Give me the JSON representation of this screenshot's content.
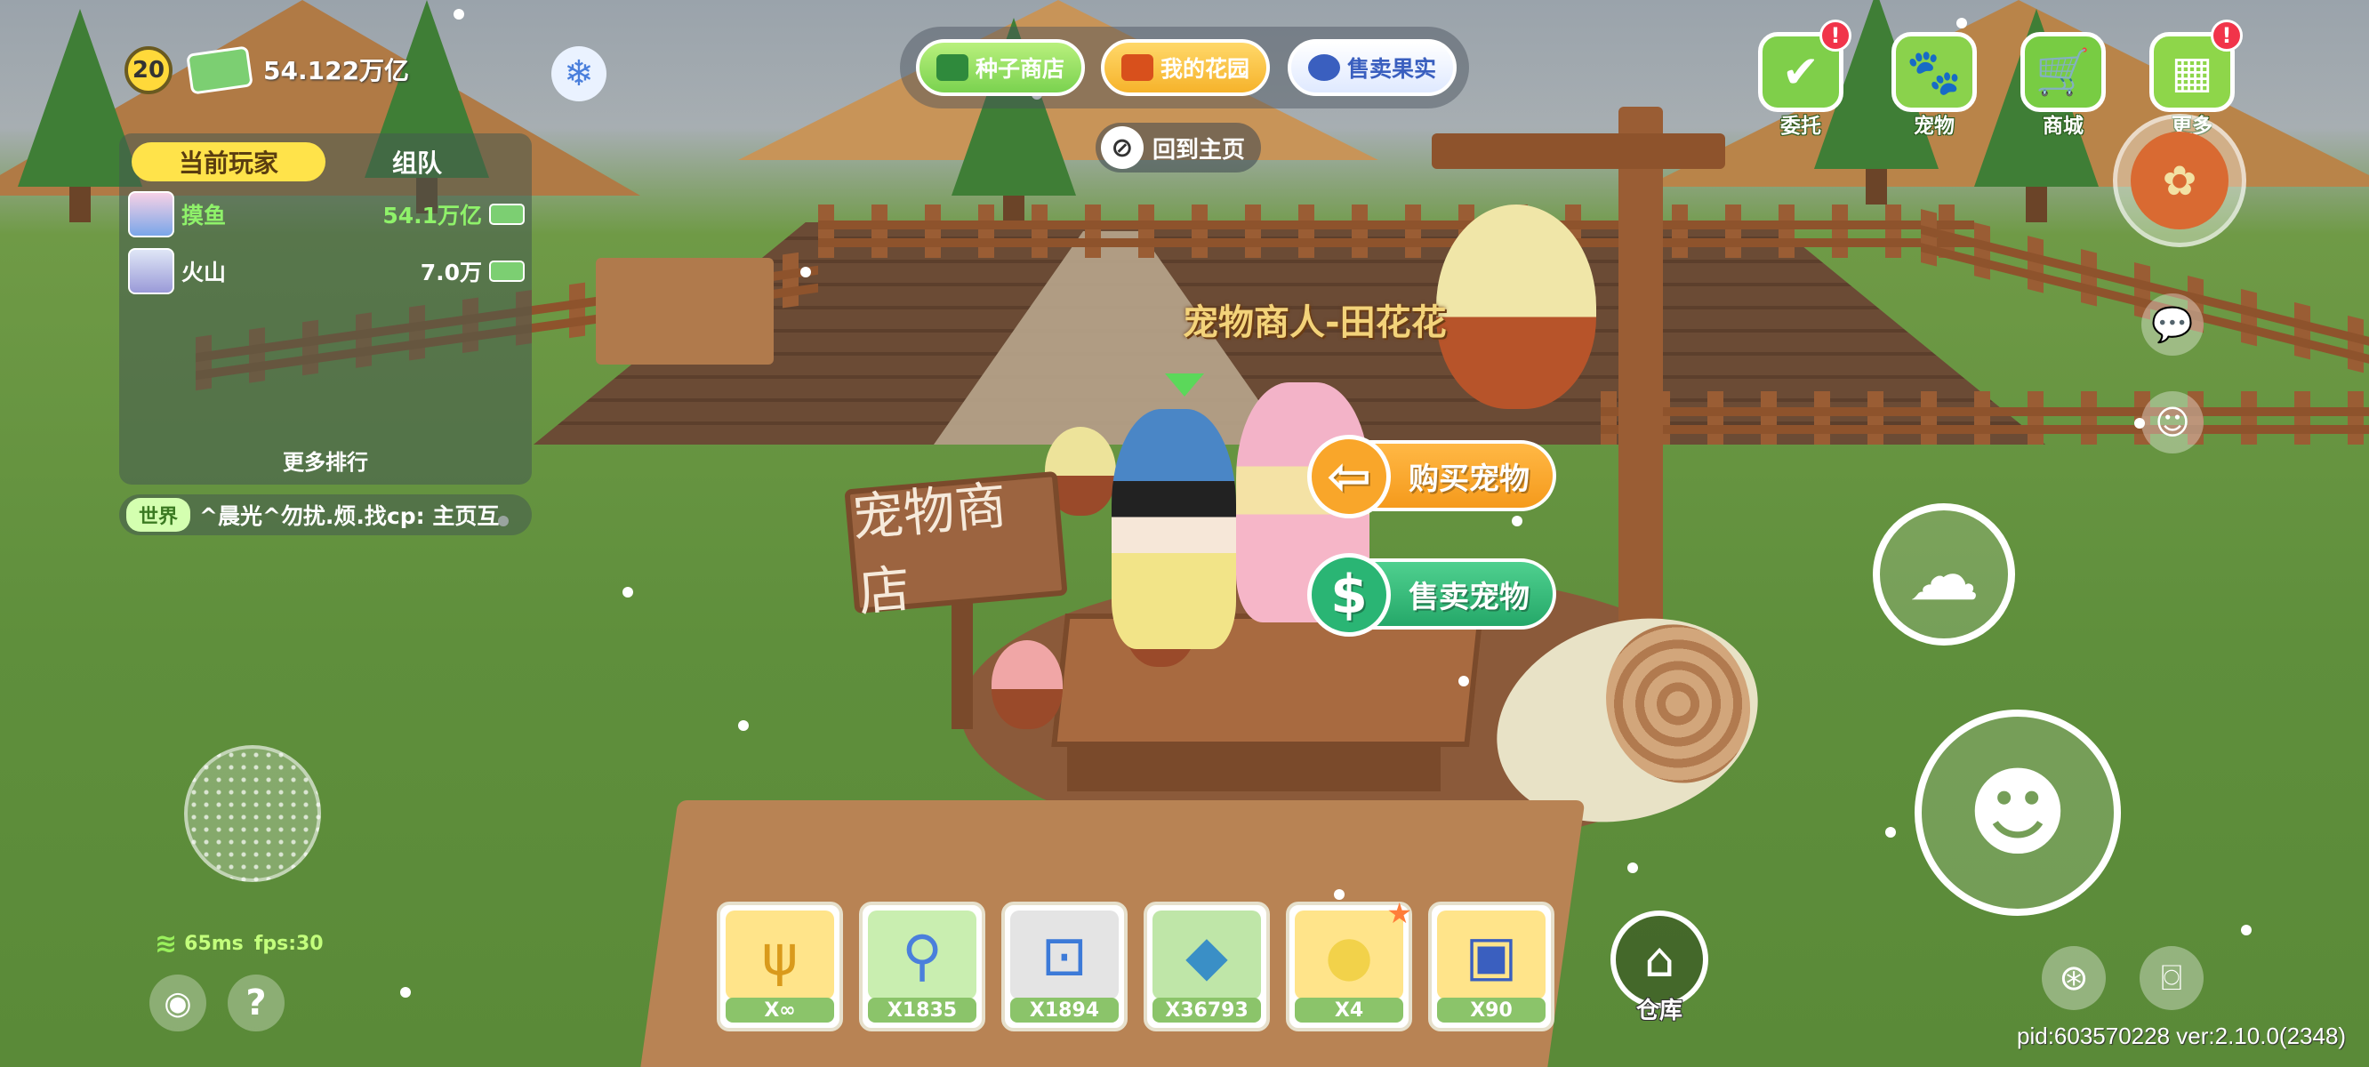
{
  "player": {
    "level": "20",
    "money": "54.122万亿"
  },
  "rank_panel": {
    "tabs": [
      "当前玩家",
      "组队"
    ],
    "rows": [
      {
        "name": "摸鱼",
        "value": "54.1万亿",
        "name_color": "#8ff26a",
        "value_color": "#8ff26a"
      },
      {
        "name": "火山",
        "value": "7.0万",
        "name_color": "#ffffff",
        "value_color": "#ffffff"
      }
    ],
    "more_label": "更多排行"
  },
  "chat": {
    "channel": "世界",
    "message": "^晨光^勿扰.烦.找cp: 主页互"
  },
  "top_nav": {
    "seed_shop": "种子商店",
    "my_garden": "我的花园",
    "sell_fruit": "售卖果实",
    "home": "回到主页"
  },
  "top_menu": [
    {
      "label": "委托",
      "icon": "delegate-icon",
      "alert": "!",
      "color": "#7fcf4a"
    },
    {
      "label": "宠物",
      "icon": "paw-icon",
      "alert": "",
      "color": "#8ad24c"
    },
    {
      "label": "商城",
      "icon": "cart-icon",
      "alert": "",
      "color": "#78cc43"
    },
    {
      "label": "更多",
      "icon": "more-icon",
      "alert": "!",
      "color": "#8ed64a"
    }
  ],
  "npc": {
    "name": "宠物商人-田花花",
    "buy_label": "购买宠物",
    "sell_label": "售卖宠物",
    "sign_text": "宠物商店"
  },
  "hotbar": [
    {
      "count": "X∞",
      "icon": "pitchfork-icon",
      "bg": "#ffe48a",
      "glyph": "ψ",
      "starred": false
    },
    {
      "count": "X1835",
      "icon": "magnifier-icon",
      "bg": "#c9eeb0",
      "glyph": "⚲",
      "starred": false
    },
    {
      "count": "X1894",
      "icon": "lock-icon",
      "bg": "#e4e4e4",
      "glyph": "🔒",
      "starred": false
    },
    {
      "count": "X36793",
      "icon": "watering-can-icon",
      "bg": "#bfe6a8",
      "glyph": "◆",
      "starred": false
    },
    {
      "count": "X4",
      "icon": "egg-icon",
      "bg": "#ffe48a",
      "glyph": "●",
      "starred": true
    },
    {
      "count": "X90",
      "icon": "chest-icon",
      "bg": "#ffe48a",
      "glyph": "▣",
      "starred": false
    }
  ],
  "warehouse_label": "仓库",
  "network": {
    "ping": "65ms",
    "fps": "fps:30"
  },
  "version": "pid:603570228 ver:2.10.0(2348)",
  "colors": {
    "accent_green": "#7ad24f",
    "accent_orange": "#f6b32b",
    "alert_red": "#f1344a"
  }
}
